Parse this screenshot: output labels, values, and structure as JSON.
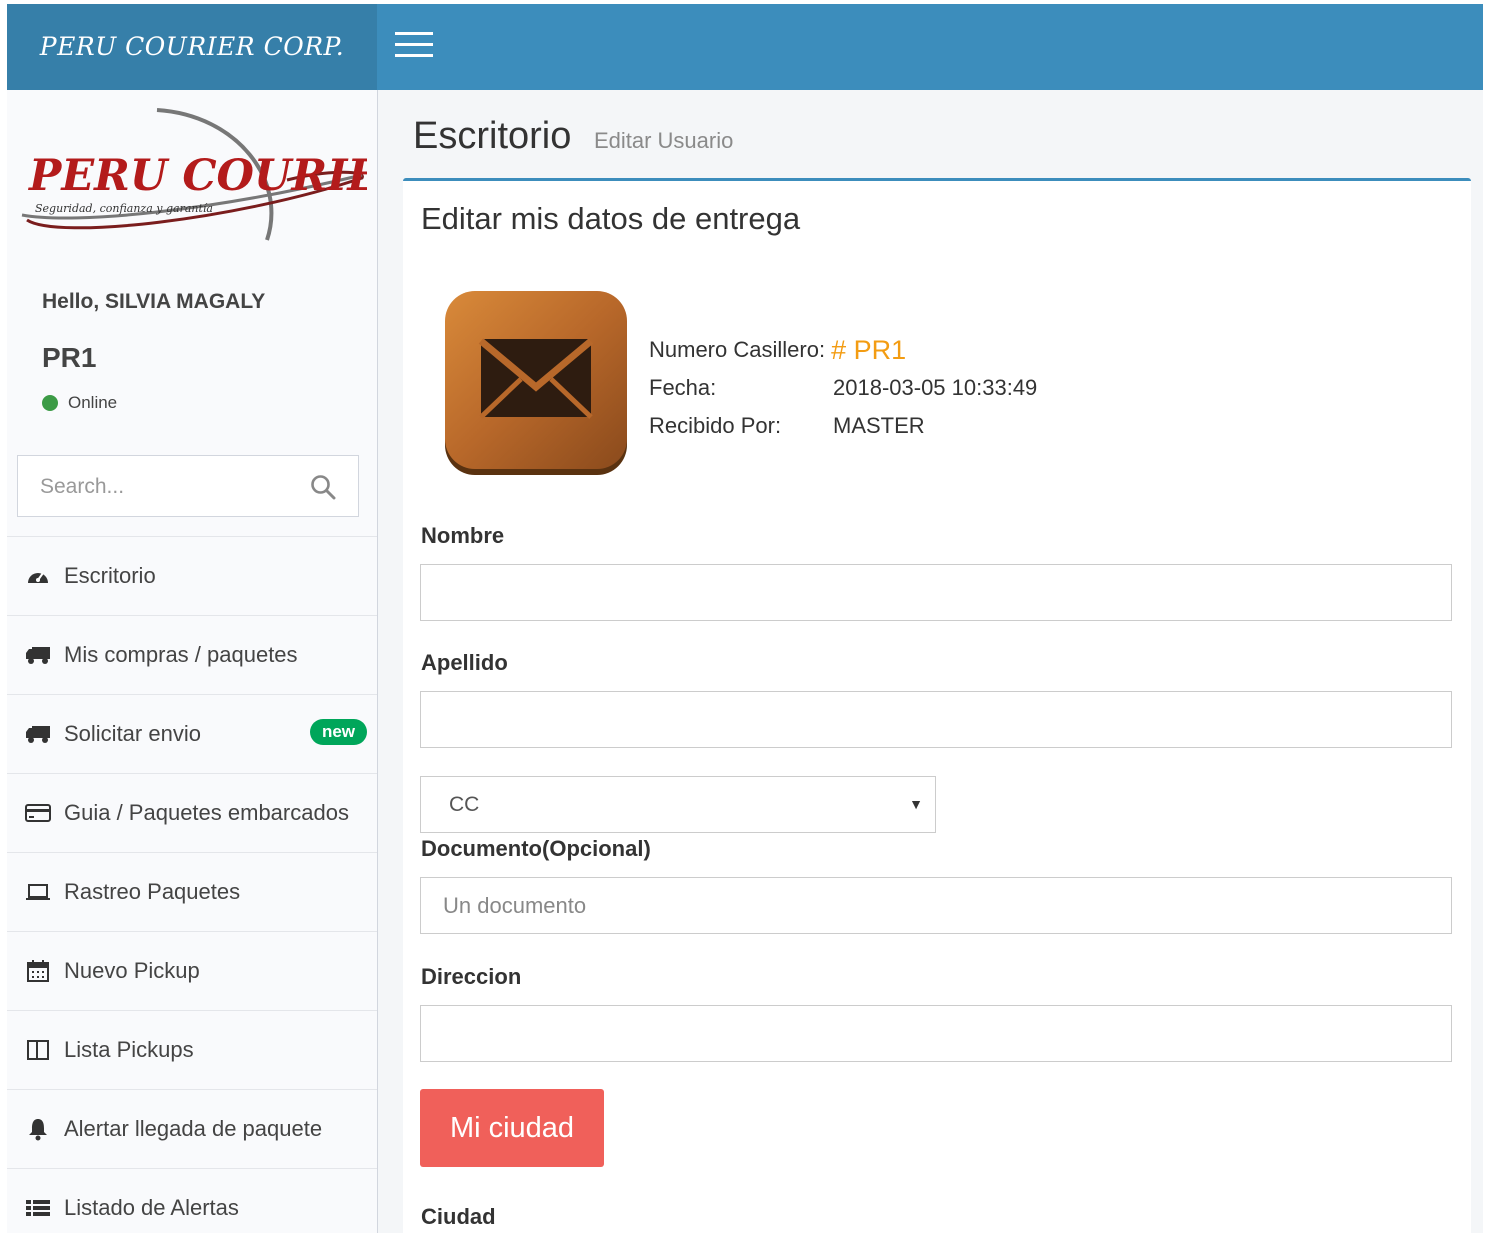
{
  "header": {
    "brand": "PERU COURIER CORP."
  },
  "sidebar": {
    "logo_text": "PERU COURIER",
    "logo_tagline": "Seguridad, confianza y garantía",
    "greeting": "Hello, SILVIA MAGALY",
    "user_code": "PR1",
    "status": "Online",
    "search_placeholder": "Search...",
    "items": [
      {
        "label": "Escritorio",
        "icon": "dashboard-icon"
      },
      {
        "label": "Mis compras / paquetes",
        "icon": "truck-icon"
      },
      {
        "label": "Solicitar envio",
        "icon": "truck-icon",
        "badge": "new"
      },
      {
        "label": "Guia / Paquetes embarcados",
        "icon": "credit-card-icon"
      },
      {
        "label": "Rastreo Paquetes",
        "icon": "laptop-icon"
      },
      {
        "label": "Nuevo Pickup",
        "icon": "calendar-icon"
      },
      {
        "label": "Lista Pickups",
        "icon": "columns-icon"
      },
      {
        "label": "Alertar llegada de paquete",
        "icon": "bell-icon"
      },
      {
        "label": "Listado de Alertas",
        "icon": "list-icon"
      }
    ]
  },
  "content": {
    "title": "Escritorio",
    "subtitle": "Editar Usuario",
    "box_title": "Editar mis datos de entrega",
    "info": {
      "casillero_label": "Numero Casillero:",
      "casillero_value": "# PR1",
      "fecha_label": "Fecha:",
      "fecha_value": "2018-03-05 10:33:49",
      "recibido_label": "Recibido Por:",
      "recibido_value": "MASTER"
    },
    "form": {
      "nombre_label": "Nombre",
      "nombre_value": "",
      "apellido_label": "Apellido",
      "apellido_value": "",
      "doc_type_selected": "CC",
      "documento_label": "Documento(Opcional)",
      "documento_placeholder": "Un documento",
      "direccion_label": "Direccion",
      "direccion_value": "",
      "city_button": "Mi ciudad",
      "ciudad_label": "Ciudad"
    }
  },
  "colors": {
    "header": "#3c8dbc",
    "brand_bg": "#367fa9",
    "accent_orange": "#f39c12",
    "button_red": "#f0605a",
    "badge_green": "#00a65a",
    "online_green": "#3c9b46"
  }
}
